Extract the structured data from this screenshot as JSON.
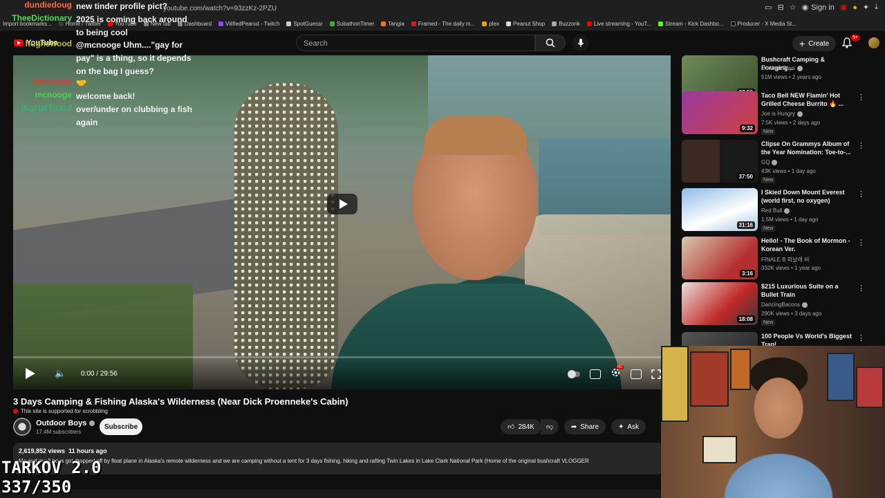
{
  "browser": {
    "url": "youtube.com/watch?v=93zzKz-2PZU",
    "sign_in": "Sign in",
    "bookmarks": [
      "Import bookmarks...",
      "Home / Twitter",
      "YouTube",
      "New tab",
      "Dashboard",
      "VilifiedPeanut - Twitch",
      "SpotGuessr",
      "SubathonTimer",
      "Tangia",
      "Framed - The daily m...",
      "plex",
      "Peanut Shop",
      "Buzzonk",
      "Live streaming - YouT...",
      "Stream - Kick Dashbo...",
      "Producer - X Media St..."
    ]
  },
  "header": {
    "logo_text": "YouTube",
    "search_placeholder": "Search",
    "create_label": "Create",
    "notif_count": "9+"
  },
  "chat": [
    {
      "name": "dundiedoug",
      "color": "#ff6a3d",
      "msg": "new tinder profile pict?"
    },
    {
      "name": "TheeDictionary",
      "color": "#5ad65a",
      "msg": "2025 is coming back around to being cool"
    },
    {
      "name": "hughswood",
      "color": "#bdbd2a",
      "msg": "@mcnooge Uhm....\"gay for pay\" is a thing, so it depends on the bag I guess?"
    },
    {
      "name": "kabonken",
      "color": "#e03a3a",
      "msg": "🤝"
    },
    {
      "name": "mcnooge",
      "color": "#4ad44a",
      "msg": "welcome back!"
    },
    {
      "name": "BigHatTizard",
      "color": "#3ab07a",
      "msg": "over/under on clubbing a fish again"
    }
  ],
  "player": {
    "time": "0:00 / 29:56"
  },
  "video": {
    "title": "3 Days Camping & Fishing Alaska's Wilderness (Near Dick Proenneke's Cabin)",
    "scrobble_note": "This site is supported for scrobbling",
    "channel": "Outdoor Boys",
    "subscribers": "17.4M subscribers",
    "subscribe_label": "Subscribe",
    "likes": "284K",
    "share_label": "Share",
    "ask_label": "Ask",
    "views": "2,619,852 views",
    "uploaded": "11 hours ago",
    "description": "Me and my 2 boys got dropped off by float plane in Alaska's remote wilderness and we are camping without a tent for 3 days fishing, hiking and rafting Twin Lakes in Lake Clark National Park (Home of the original bushcraft VLOGGER"
  },
  "overlay": {
    "game": "TARKOV 2.0",
    "counter": "337/350"
  },
  "recommendations": [
    {
      "title": "Bushcraft Camping & Foraging...",
      "channel": "Outdoor Boys",
      "verified": true,
      "stats": "51M views • 2 years ago",
      "duration": "27:56",
      "new": "",
      "thumb_color": "#5a6e4a"
    },
    {
      "title": "Taco Bell NEW Flamin' Hot Grilled Cheese Burrito 🔥 ...",
      "channel": "Joe is Hungry",
      "verified": true,
      "stats": "7.5K views • 2 days ago",
      "duration": "9:32",
      "new": "New",
      "thumb_color": "#8a2a86"
    },
    {
      "title": "Clipse On Grammys Album of the Year Nomination: Toe-to-...",
      "channel": "GQ",
      "verified": true,
      "stats": "43K views • 1 day ago",
      "duration": "37:50",
      "new": "New",
      "thumb_color": "#2a2a2a"
    },
    {
      "title": "I Skied Down Mount Everest (world first, no oxygen)",
      "channel": "Red Bull",
      "verified": true,
      "stats": "1.5M views • 1 day ago",
      "duration": "31:16",
      "new": "New",
      "thumb_color": "#5b8fc7"
    },
    {
      "title": "Hello! - The Book of Mormon - Korean Ver.",
      "channel": "FINALE B 피날레 비",
      "verified": false,
      "stats": "332K views • 1 year ago",
      "duration": "3:16",
      "new": "",
      "thumb_color": "#c8b8a0"
    },
    {
      "title": "$215 Luxurious Suite on a Bullet Train",
      "channel": "DancingBacons",
      "verified": true,
      "stats": "290K views • 3 days ago",
      "duration": "18:08",
      "new": "New",
      "thumb_color": "#b03030"
    },
    {
      "title": "100 People Vs World's Biggest Trap!",
      "channel": "",
      "verified": false,
      "stats": "",
      "duration": "",
      "new": "",
      "thumb_color": "#444444"
    }
  ]
}
